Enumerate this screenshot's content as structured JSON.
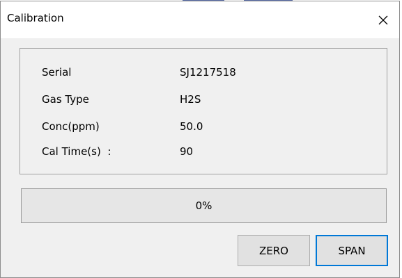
{
  "window": {
    "title": "Calibration"
  },
  "info": {
    "rows": [
      {
        "label": "Serial",
        "value": "SJ1217518"
      },
      {
        "label": "Gas Type",
        "value": "H2S"
      },
      {
        "label": "Conc(ppm)",
        "value": "50.0"
      },
      {
        "label": "Cal Time(s)  :",
        "value": "90"
      }
    ]
  },
  "progress": {
    "text": "0%",
    "value": 0
  },
  "buttons": {
    "zero_label": "ZERO",
    "span_label": "SPAN"
  },
  "icons": {
    "close": "close-icon"
  },
  "colors": {
    "dialog_bg": "#f0f0f0",
    "title_bg": "#ffffff",
    "focus_border": "#0078d7",
    "progress_fill": "#06b025"
  }
}
